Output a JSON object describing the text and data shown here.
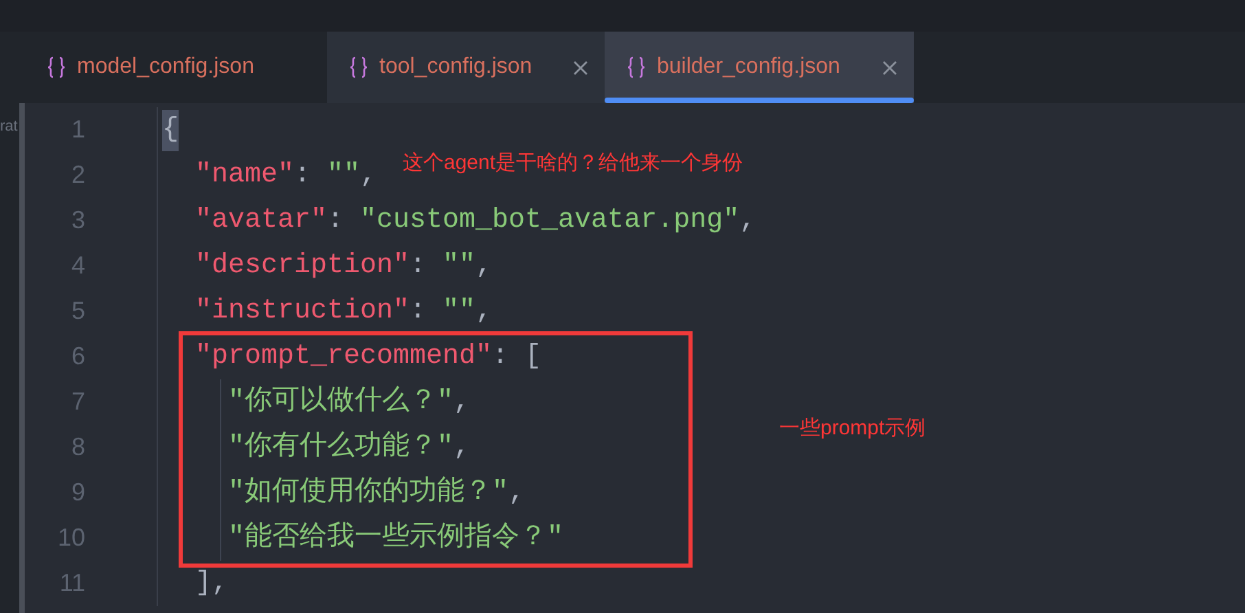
{
  "sidebar_fragment": {
    "text": "rat"
  },
  "tabs": [
    {
      "label": "model_config.json",
      "selected": false,
      "closable": false
    },
    {
      "label": "tool_config.json",
      "selected": false,
      "closable": true
    },
    {
      "label": "builder_config.json",
      "selected": true,
      "closable": true
    }
  ],
  "editor": {
    "lines": [
      {
        "number": "1",
        "tokens": [
          {
            "kind": "punct",
            "text": "{",
            "matched": true
          }
        ],
        "children": [
          {
            "number": "2",
            "tokens": [
              {
                "kind": "key",
                "text": "\"name\""
              },
              {
                "kind": "punct",
                "text": ": "
              },
              {
                "kind": "string",
                "text": "\"\""
              },
              {
                "kind": "punct",
                "text": ","
              }
            ]
          },
          {
            "number": "3",
            "tokens": [
              {
                "kind": "key",
                "text": "\"avatar\""
              },
              {
                "kind": "punct",
                "text": ": "
              },
              {
                "kind": "string",
                "text": "\"custom_bot_avatar.png\""
              },
              {
                "kind": "punct",
                "text": ","
              }
            ]
          },
          {
            "number": "4",
            "tokens": [
              {
                "kind": "key",
                "text": "\"description\""
              },
              {
                "kind": "punct",
                "text": ": "
              },
              {
                "kind": "string",
                "text": "\"\""
              },
              {
                "kind": "punct",
                "text": ","
              }
            ]
          },
          {
            "number": "5",
            "tokens": [
              {
                "kind": "key",
                "text": "\"instruction\""
              },
              {
                "kind": "punct",
                "text": ": "
              },
              {
                "kind": "string",
                "text": "\"\""
              },
              {
                "kind": "punct",
                "text": ","
              }
            ]
          },
          {
            "number": "6",
            "tokens": [
              {
                "kind": "key",
                "text": "\"prompt_recommend\""
              },
              {
                "kind": "punct",
                "text": ": ["
              }
            ],
            "children": [
              {
                "number": "7",
                "tokens": [
                  {
                    "kind": "string",
                    "text": "\"你可以做什么？\""
                  },
                  {
                    "kind": "punct",
                    "text": ","
                  }
                ]
              },
              {
                "number": "8",
                "tokens": [
                  {
                    "kind": "string",
                    "text": "\"你有什么功能？\""
                  },
                  {
                    "kind": "punct",
                    "text": ","
                  }
                ]
              },
              {
                "number": "9",
                "tokens": [
                  {
                    "kind": "string",
                    "text": "\"如何使用你的功能？\""
                  },
                  {
                    "kind": "punct",
                    "text": ","
                  }
                ]
              },
              {
                "number": "10",
                "tokens": [
                  {
                    "kind": "string",
                    "text": "\"能否给我一些示例指令？\""
                  }
                ]
              }
            ]
          },
          {
            "number": "11",
            "tokens": [
              {
                "kind": "punct",
                "text": "],"
              }
            ]
          }
        ]
      }
    ]
  },
  "annotations": [
    {
      "kind": "note",
      "text": "这个agent是干啥的？给他来一个身份"
    },
    {
      "kind": "note",
      "text": "一些prompt示例"
    }
  ]
}
